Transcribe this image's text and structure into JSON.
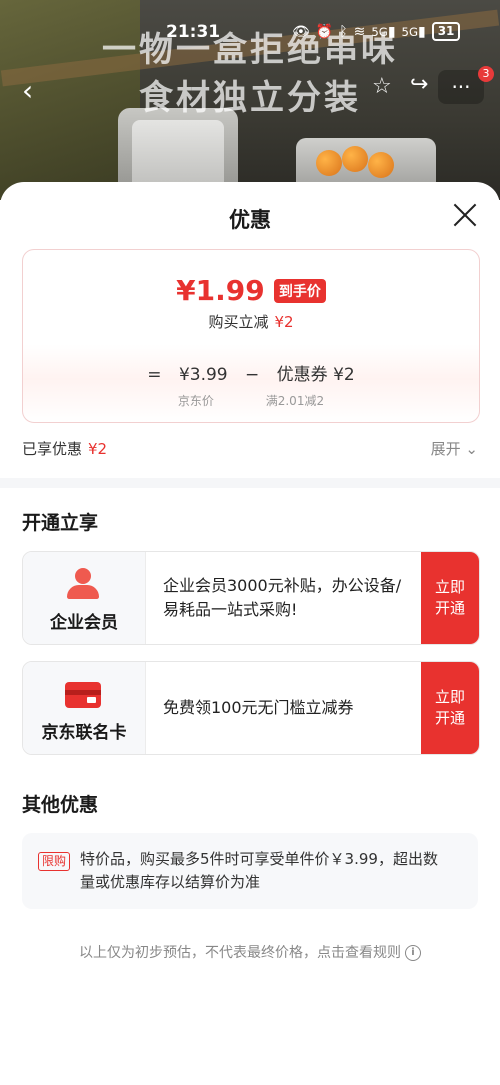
{
  "background": {
    "headline_line1": "一物一盒拒绝串味",
    "headline_line2": "食材独立分装"
  },
  "status_bar": {
    "time": "21:31",
    "network_1": "5G",
    "network_2": "5G",
    "battery": "31"
  },
  "top_nav": {
    "more_badge": "3"
  },
  "sheet": {
    "title": "优惠",
    "price": "¥1.99",
    "price_tag": "到手价",
    "reduce_label": "购买立减",
    "reduce_value": "¥2",
    "calc": {
      "equals": "=",
      "jd_price": "¥3.99",
      "minus": "−",
      "coupon": "优惠券 ¥2",
      "jd_price_label": "京东价",
      "coupon_rule": "满2.01减2"
    },
    "enjoyed_label": "已享优惠",
    "enjoyed_value": "¥2",
    "expand_label": "展开"
  },
  "open_section": {
    "title": "开通立享",
    "offers": [
      {
        "name": "企业会员",
        "desc": "企业会员3000元补贴，办公设备/易耗品一站式采购!",
        "button": "立即开通",
        "icon": "person-icon"
      },
      {
        "name": "京东联名卡",
        "desc": "免费领100元无门槛立减券",
        "button": "立即开通",
        "icon": "credit-card-icon"
      }
    ]
  },
  "other_section": {
    "title": "其他优惠",
    "tag": "限购",
    "text": "特价品，购买最多5件时可享受单件价￥3.99，超出数量或优惠库存以结算价为准"
  },
  "footnote": "以上仅为初步预估，不代表最终价格，点击查看规则",
  "colors": {
    "accent": "#e8322f"
  }
}
